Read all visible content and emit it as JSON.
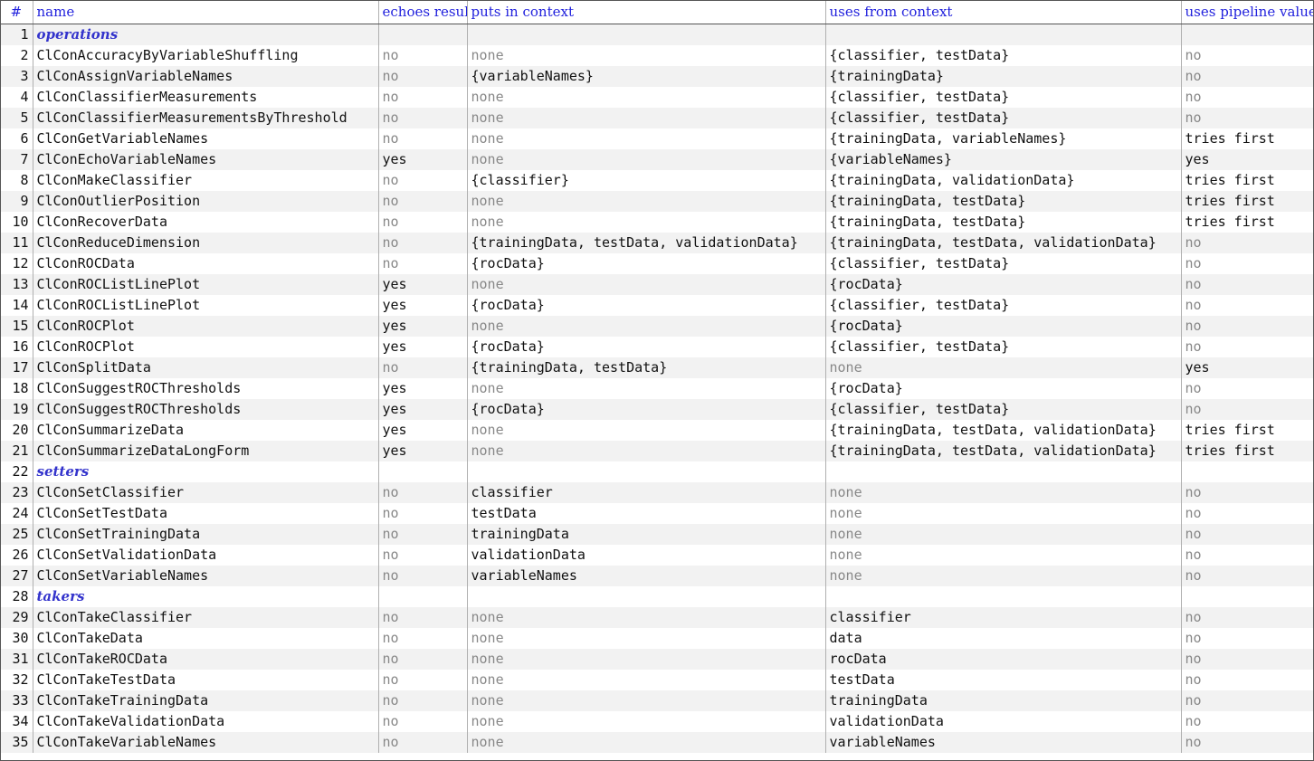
{
  "table": {
    "columns": [
      {
        "key": "num",
        "label": "#"
      },
      {
        "key": "name",
        "label": "name"
      },
      {
        "key": "echo",
        "label": "echoes result"
      },
      {
        "key": "puts",
        "label": "puts in context"
      },
      {
        "key": "uses",
        "label": "uses from context"
      },
      {
        "key": "pipe",
        "label": "uses pipeline value"
      }
    ],
    "rows": [
      {
        "num": "1",
        "type": "section",
        "name": "operations"
      },
      {
        "num": "2",
        "type": "data",
        "name": "ClConAccuracyByVariableShuffling",
        "echo": "no",
        "puts": "none",
        "uses": "{classifier, testData}",
        "pipe": "no"
      },
      {
        "num": "3",
        "type": "data",
        "name": "ClConAssignVariableNames",
        "echo": "no",
        "puts": "{variableNames}",
        "uses": "{trainingData}",
        "pipe": "no"
      },
      {
        "num": "4",
        "type": "data",
        "name": "ClConClassifierMeasurements",
        "echo": "no",
        "puts": "none",
        "uses": "{classifier, testData}",
        "pipe": "no"
      },
      {
        "num": "5",
        "type": "data",
        "name": "ClConClassifierMeasurementsByThreshold",
        "echo": "no",
        "puts": "none",
        "uses": "{classifier, testData}",
        "pipe": "no"
      },
      {
        "num": "6",
        "type": "data",
        "name": "ClConGetVariableNames",
        "echo": "no",
        "puts": "none",
        "uses": "{trainingData, variableNames}",
        "pipe": "tries first"
      },
      {
        "num": "7",
        "type": "data",
        "name": "ClConEchoVariableNames",
        "echo": "yes",
        "puts": "none",
        "uses": "{variableNames}",
        "pipe": "yes"
      },
      {
        "num": "8",
        "type": "data",
        "name": "ClConMakeClassifier",
        "echo": "no",
        "puts": "{classifier}",
        "uses": "{trainingData, validationData}",
        "pipe": "tries first"
      },
      {
        "num": "9",
        "type": "data",
        "name": "ClConOutlierPosition",
        "echo": "no",
        "puts": "none",
        "uses": "{trainingData, testData}",
        "pipe": "tries first"
      },
      {
        "num": "10",
        "type": "data",
        "name": "ClConRecoverData",
        "echo": "no",
        "puts": "none",
        "uses": "{trainingData, testData}",
        "pipe": "tries first"
      },
      {
        "num": "11",
        "type": "data",
        "name": "ClConReduceDimension",
        "echo": "no",
        "puts": "{trainingData, testData, validationData}",
        "uses": "{trainingData, testData, validationData}",
        "pipe": "no"
      },
      {
        "num": "12",
        "type": "data",
        "name": "ClConROCData",
        "echo": "no",
        "puts": "{rocData}",
        "uses": "{classifier, testData}",
        "pipe": "no"
      },
      {
        "num": "13",
        "type": "data",
        "name": "ClConROCListLinePlot",
        "echo": "yes",
        "puts": "none",
        "uses": "{rocData}",
        "pipe": "no"
      },
      {
        "num": "14",
        "type": "data",
        "name": "ClConROCListLinePlot",
        "echo": "yes",
        "puts": "{rocData}",
        "uses": "{classifier, testData}",
        "pipe": "no"
      },
      {
        "num": "15",
        "type": "data",
        "name": "ClConROCPlot",
        "echo": "yes",
        "puts": "none",
        "uses": "{rocData}",
        "pipe": "no"
      },
      {
        "num": "16",
        "type": "data",
        "name": "ClConROCPlot",
        "echo": "yes",
        "puts": "{rocData}",
        "uses": "{classifier, testData}",
        "pipe": "no"
      },
      {
        "num": "17",
        "type": "data",
        "name": "ClConSplitData",
        "echo": "no",
        "puts": "{trainingData, testData}",
        "uses": "none",
        "pipe": "yes"
      },
      {
        "num": "18",
        "type": "data",
        "name": "ClConSuggestROCThresholds",
        "echo": "yes",
        "puts": "none",
        "uses": "{rocData}",
        "pipe": "no"
      },
      {
        "num": "19",
        "type": "data",
        "name": "ClConSuggestROCThresholds",
        "echo": "yes",
        "puts": "{rocData}",
        "uses": "{classifier, testData}",
        "pipe": "no"
      },
      {
        "num": "20",
        "type": "data",
        "name": "ClConSummarizeData",
        "echo": "yes",
        "puts": "none",
        "uses": "{trainingData, testData, validationData}",
        "pipe": "tries first"
      },
      {
        "num": "21",
        "type": "data",
        "name": "ClConSummarizeDataLongForm",
        "echo": "yes",
        "puts": "none",
        "uses": "{trainingData, testData, validationData}",
        "pipe": "tries first"
      },
      {
        "num": "22",
        "type": "section",
        "name": "setters"
      },
      {
        "num": "23",
        "type": "data",
        "name": "ClConSetClassifier",
        "echo": "no",
        "puts": "classifier",
        "uses": "none",
        "pipe": "no"
      },
      {
        "num": "24",
        "type": "data",
        "name": "ClConSetTestData",
        "echo": "no",
        "puts": "testData",
        "uses": "none",
        "pipe": "no"
      },
      {
        "num": "25",
        "type": "data",
        "name": "ClConSetTrainingData",
        "echo": "no",
        "puts": "trainingData",
        "uses": "none",
        "pipe": "no"
      },
      {
        "num": "26",
        "type": "data",
        "name": "ClConSetValidationData",
        "echo": "no",
        "puts": "validationData",
        "uses": "none",
        "pipe": "no"
      },
      {
        "num": "27",
        "type": "data",
        "name": "ClConSetVariableNames",
        "echo": "no",
        "puts": "variableNames",
        "uses": "none",
        "pipe": "no"
      },
      {
        "num": "28",
        "type": "section",
        "name": "takers"
      },
      {
        "num": "29",
        "type": "data",
        "name": "ClConTakeClassifier",
        "echo": "no",
        "puts": "none",
        "uses": "classifier",
        "pipe": "no"
      },
      {
        "num": "30",
        "type": "data",
        "name": "ClConTakeData",
        "echo": "no",
        "puts": "none",
        "uses": "data",
        "pipe": "no"
      },
      {
        "num": "31",
        "type": "data",
        "name": "ClConTakeROCData",
        "echo": "no",
        "puts": "none",
        "uses": "rocData",
        "pipe": "no"
      },
      {
        "num": "32",
        "type": "data",
        "name": "ClConTakeTestData",
        "echo": "no",
        "puts": "none",
        "uses": "testData",
        "pipe": "no"
      },
      {
        "num": "33",
        "type": "data",
        "name": "ClConTakeTrainingData",
        "echo": "no",
        "puts": "none",
        "uses": "trainingData",
        "pipe": "no"
      },
      {
        "num": "34",
        "type": "data",
        "name": "ClConTakeValidationData",
        "echo": "no",
        "puts": "none",
        "uses": "validationData",
        "pipe": "no"
      },
      {
        "num": "35",
        "type": "data",
        "name": "ClConTakeVariableNames",
        "echo": "no",
        "puts": "none",
        "uses": "variableNames",
        "pipe": "no"
      }
    ]
  },
  "colors": {
    "header_text": "#2222dd",
    "section_text": "#3333cc",
    "dim_text": "#888888",
    "body_text": "#111111",
    "stripe": "#f2f2f2",
    "rule": "#b0b0b0",
    "frame": "#555555"
  }
}
